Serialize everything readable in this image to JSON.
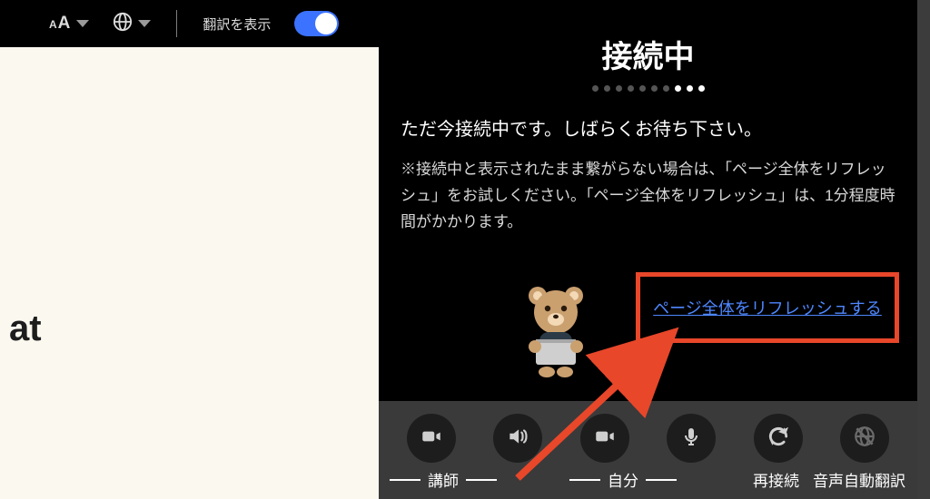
{
  "toolbar": {
    "translate_label": "翻訳を表示",
    "translate_on": true
  },
  "document": {
    "fragment": "at"
  },
  "panel": {
    "title": "接続中",
    "message": "ただ今接続中です。しばらくお待ち下さい。",
    "note": "※接続中と表示されたまま繋がらない場合は、「ページ全体をリフレッシュ」をお試しください。「ページ全体をリフレッシュ」は、1分程度時間がかかります。",
    "refresh_link": "ページ全体をリフレッシュする"
  },
  "controls": {
    "teacher": "講師",
    "self": "自分",
    "reconnect": "再接続",
    "auto_translate": "音声自動翻訳"
  },
  "colors": {
    "highlight": "#e8472a",
    "link": "#4e87ff",
    "toggle_on": "#3b72ff"
  }
}
